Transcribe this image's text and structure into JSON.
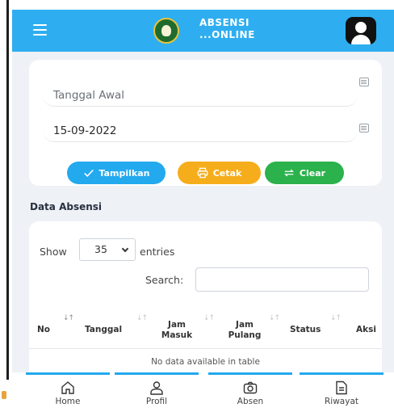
{
  "header": {
    "brand_line1": "ABSENSI",
    "brand_line2": "...ONLINE",
    "menu_icon": "hamburger-icon",
    "profile_icon": "user-avatar-icon"
  },
  "filter": {
    "start_date_placeholder": "Tanggal Awal",
    "end_date_value": "15-09-2022",
    "show_button": "Tampilkan",
    "print_button": "Cetak",
    "clear_button": "Clear"
  },
  "table_section": {
    "title": "Data Absensi",
    "show_label": "Show",
    "page_size": "35",
    "entries_label": "entries",
    "search_label": "Search:",
    "columns": [
      "No",
      "Tanggal",
      "Jam Masuk",
      "Jam Pulang",
      "Status",
      "Aksi"
    ],
    "empty_message": "No data available in table"
  },
  "bottom_nav": {
    "items": [
      {
        "label": "Home",
        "icon": "home-icon"
      },
      {
        "label": "Profil",
        "icon": "profile-icon"
      },
      {
        "label": "Absen",
        "icon": "camera-icon"
      },
      {
        "label": "Riwayat",
        "icon": "document-icon"
      }
    ]
  },
  "colors": {
    "primary": "#2eaef0",
    "warning": "#f6ad1b",
    "success": "#2bb24c",
    "background": "#eef1f5"
  }
}
